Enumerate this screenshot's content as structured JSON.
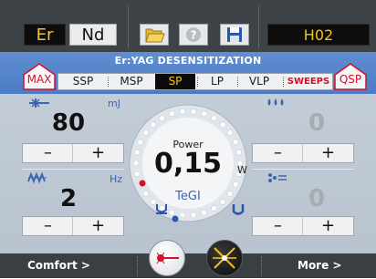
{
  "topbar": {
    "wavelength_er": "Er",
    "wavelength_nd": "Nd",
    "open_icon": "folder-open-icon",
    "help_icon": "help-icon",
    "save_icon": "floppy-save-icon",
    "mode_code": "H02"
  },
  "mode": {
    "title": "Er:YAG DESENSITIZATION",
    "max_label": "MAX",
    "qsp_label": "QSP",
    "pulse_modes": [
      {
        "label": "SSP"
      },
      {
        "label": "MSP"
      },
      {
        "label": "SP"
      },
      {
        "label": "LP"
      },
      {
        "label": "VLP"
      },
      {
        "label": "SWEEPS"
      }
    ],
    "active_pulse_mode": "SP"
  },
  "left": {
    "energy": {
      "unit": "mJ",
      "value": "80",
      "icon": "pulse-energy-icon"
    },
    "frequency": {
      "unit": "Hz",
      "value": "2",
      "icon": "frequency-wave-icon"
    },
    "minus": "–",
    "plus": "+"
  },
  "right": {
    "water": {
      "value": "0",
      "icon": "water-drops-icon"
    },
    "air": {
      "value": "0",
      "icon": "air-spray-icon"
    },
    "minus": "–",
    "plus": "+"
  },
  "center": {
    "power_label": "Power",
    "power_value": "0,15",
    "power_unit": "W",
    "handpiece": "TeGI"
  },
  "bottom": {
    "comfort_label": "Comfort >",
    "more_label": "More >",
    "aim_icon": "aiming-beam-icon",
    "laser_icon": "laser-standby-icon"
  },
  "colors": {
    "accent_yellow": "#f3c51d",
    "mode_band_blue": "#5f8ed1",
    "sweeps_red": "#d0112b",
    "dark_bar": "#3e4347"
  }
}
